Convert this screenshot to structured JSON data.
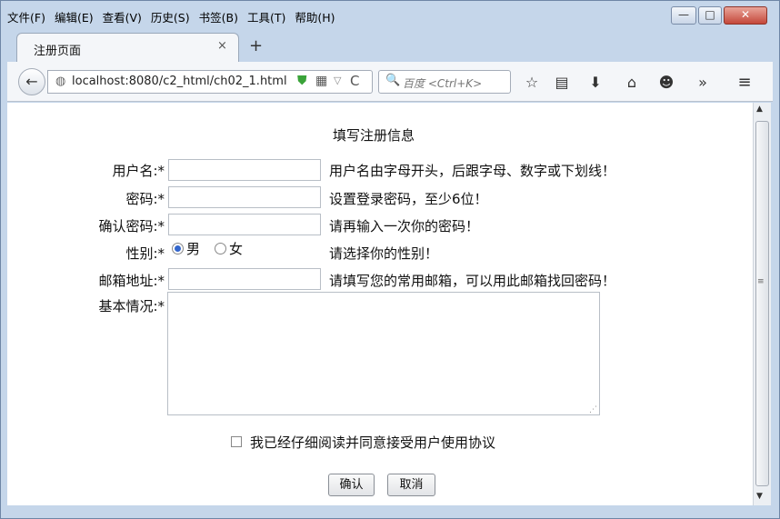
{
  "menu": [
    "文件(F)",
    "编辑(E)",
    "查看(V)",
    "历史(S)",
    "书签(B)",
    "工具(T)",
    "帮助(H)"
  ],
  "window": {
    "min": "—",
    "max": "□",
    "close": "✕"
  },
  "tab": {
    "title": "注册页面",
    "close": "×",
    "new": "+"
  },
  "nav": {
    "back": "←",
    "url": "localhost:8080/c2_html/ch02_1.html",
    "search_placeholder": "百度 <Ctrl+K>"
  },
  "icons": {
    "globe": "◍",
    "shield": "⛊",
    "qr": "▦",
    "dropdown": "▽",
    "reload": "C",
    "search": "🔍",
    "star": "☆",
    "reader": "▤",
    "download": "⬇",
    "home": "⌂",
    "chat": "☻",
    "more": "»",
    "menu": "≡",
    "scroll_up": "▲",
    "scroll_down": "▼",
    "grip": "≡",
    "resize": "⋰"
  },
  "form": {
    "title": "填写注册信息",
    "username": {
      "label": "用户名:*",
      "value": "",
      "hint": "用户名由字母开头，后跟字母、数字或下划线！"
    },
    "password": {
      "label": "密码:*",
      "value": "",
      "hint": "设置登录密码，至少6位！"
    },
    "confirm_password": {
      "label": "确认密码:*",
      "value": "",
      "hint": "请再输入一次你的密码！"
    },
    "gender": {
      "label": "性别:*",
      "male": "男",
      "female": "女",
      "selected": "男",
      "hint": "请选择你的性别！"
    },
    "email": {
      "label": "邮箱地址:*",
      "value": "",
      "hint": "请填写您的常用邮箱，可以用此邮箱找回密码！"
    },
    "basic_info": {
      "label": "基本情况:*",
      "value": ""
    },
    "agree": {
      "label": "我已经仔细阅读并同意接受用户使用协议",
      "checked": false
    },
    "buttons": {
      "confirm": "确认",
      "cancel": "取消"
    }
  }
}
